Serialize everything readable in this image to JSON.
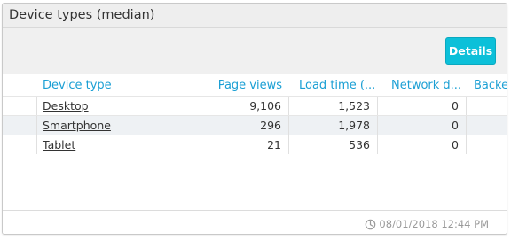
{
  "panel": {
    "title": "Device types (median)",
    "details_label": "Details"
  },
  "table": {
    "columns": [
      "Device type",
      "Page views",
      "Load time (...",
      "Network d...",
      "Backen"
    ],
    "rows": [
      {
        "device": "Desktop",
        "page_views": "9,106",
        "load_time": "1,523",
        "network": "0"
      },
      {
        "device": "Smartphone",
        "page_views": "296",
        "load_time": "1,978",
        "network": "0"
      },
      {
        "device": "Tablet",
        "page_views": "21",
        "load_time": "536",
        "network": "0"
      }
    ]
  },
  "footer": {
    "timestamp": "08/01/2018 12:44 PM",
    "icon": "clock-icon"
  },
  "colors": {
    "accent": "#0cc0d9",
    "header_text": "#1a9fd4",
    "alt_row": "#eef1f4"
  }
}
